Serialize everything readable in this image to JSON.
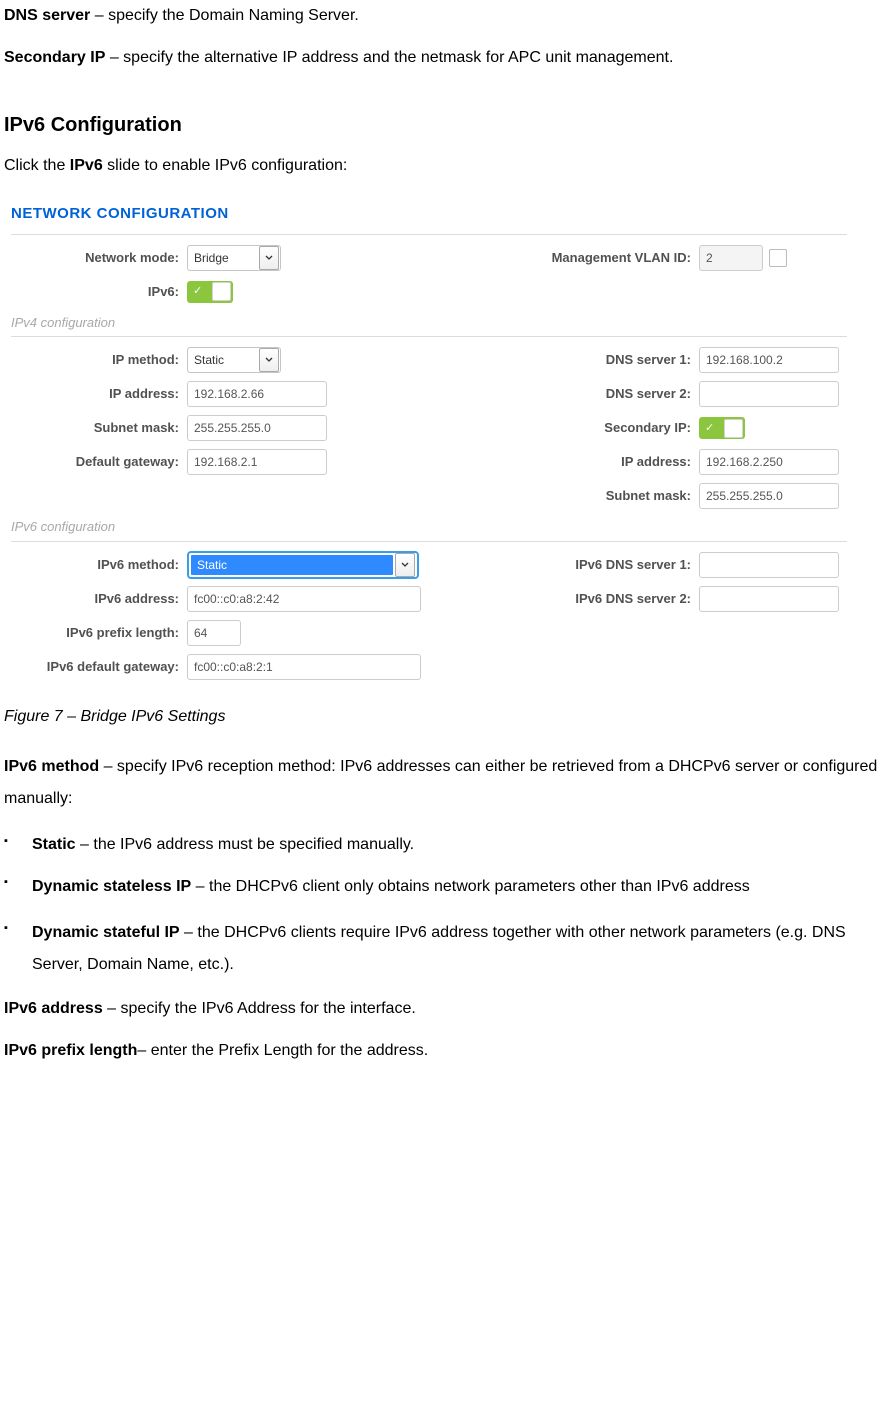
{
  "para": {
    "dns": "DNS server",
    "dns_t": " – specify the Domain Naming Server.",
    "sec": "Secondary IP",
    "sec_t": " – specify the alternative IP address and the netmask for APC unit management.",
    "ipv6cfg": "IPv6 Configuration",
    "click_ipv6": "Click the ",
    "click_ipv6_b": "IPv6",
    "click_ipv6_t": " slide to enable IPv6 configuration:",
    "fig7": "Figure 7 – Bridge IPv6 Settings",
    "ipv6method_b": "IPv6 method",
    "ipv6method_t": " – specify IPv6 reception method: IPv6 addresses can either be retrieved from a DHCPv6 server or configured manually:",
    "static_b": "Static",
    "static_t": " – the IPv6 address must be specified manually.",
    "dsl_b": "Dynamic stateless IP",
    "dsl_t": " – the DHCPv6 client only obtains network parameters other than IPv6 address",
    "dsf_b": "Dynamic stateful IP",
    "dsf_t": " – the DHCPv6 clients require IPv6 address together with other network parameters (e.g. DNS Server, Domain Name, etc.).",
    "ipv6addr_b": "IPv6 address",
    "ipv6addr_t": " – specify the IPv6 Address for the interface.",
    "ipv6pl_b": "IPv6 prefix length",
    "ipv6pl_t": "– enter the Prefix Length for the address."
  },
  "shot": {
    "title": "NETWORK CONFIGURATION",
    "ipv4_sub": "IPv4 configuration",
    "ipv6_sub": "IPv6 configuration",
    "labels": {
      "network_mode": "Network mode:",
      "ipv6": "IPv6:",
      "vlan": "Management VLAN ID:",
      "ip_method": "IP method:",
      "ip_address": "IP address:",
      "subnet_mask": "Subnet mask:",
      "default_gw": "Default gateway:",
      "dns1": "DNS server 1:",
      "dns2": "DNS server 2:",
      "secondary_ip": "Secondary IP:",
      "ipv6_method": "IPv6 method:",
      "ipv6_address": "IPv6 address:",
      "ipv6_prefix": "IPv6 prefix length:",
      "ipv6_gw": "IPv6 default gateway:",
      "ipv6_dns1": "IPv6 DNS server 1:",
      "ipv6_dns2": "IPv6 DNS server 2:"
    },
    "vals": {
      "network_mode": "Bridge",
      "vlan": "2",
      "ip_method": "Static",
      "ip_address": "192.168.2.66",
      "subnet_mask": "255.255.255.0",
      "default_gw": "192.168.2.1",
      "dns1": "192.168.100.2",
      "dns2": "",
      "sec_ip": "192.168.2.250",
      "sec_mask": "255.255.255.0",
      "ipv6_method": "Static",
      "ipv6_address": "fc00::c0:a8:2:42",
      "ipv6_prefix": "64",
      "ipv6_gw": "fc00::c0:a8:2:1",
      "ipv6_dns1": "",
      "ipv6_dns2": ""
    }
  }
}
